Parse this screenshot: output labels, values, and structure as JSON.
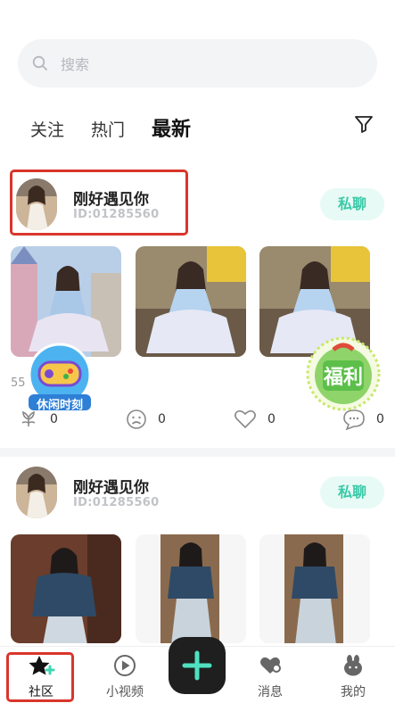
{
  "search": {
    "placeholder": "搜索"
  },
  "tabs": [
    {
      "label": "关注",
      "active": false
    },
    {
      "label": "热门",
      "active": false
    },
    {
      "label": "最新",
      "active": true
    }
  ],
  "posts": [
    {
      "username": "刚好遇见你",
      "user_id": "ID:01285560",
      "chat_label": "私聊",
      "media_counter": "55",
      "likes": "0",
      "dislikes": "0",
      "hearts": "0",
      "comments": "0"
    },
    {
      "username": "刚好遇见你",
      "user_id": "ID:01285560",
      "chat_label": "私聊"
    }
  ],
  "badges": {
    "leisure": "休闲时刻",
    "welfare": "福利"
  },
  "nav": {
    "community": "社区",
    "short_video": "小视频",
    "messages": "消息",
    "mine": "我的"
  },
  "colors": {
    "accent": "#39c9a7",
    "accent_bg": "#e7faf5",
    "highlight": "#d9352b",
    "tab_underline": "#63e3c8"
  }
}
